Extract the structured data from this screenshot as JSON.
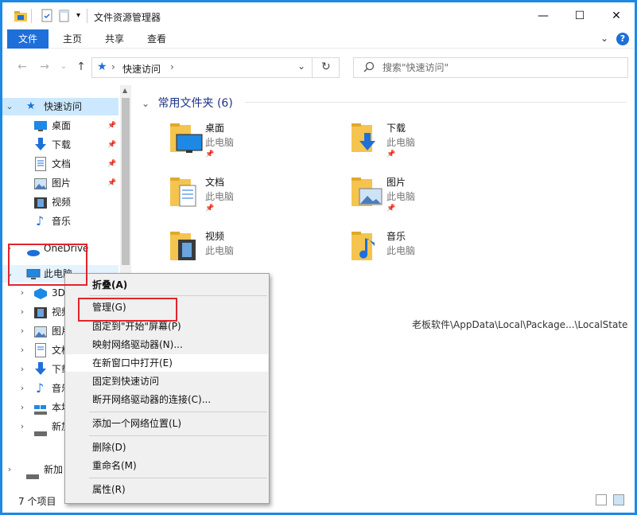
{
  "window": {
    "title": "文件资源管理器",
    "minimize_label": "—",
    "maximize_label": "☐",
    "close_label": "✕"
  },
  "ribbon": {
    "tabs": [
      "文件",
      "主页",
      "共享",
      "查看"
    ],
    "expand_label": "⌄",
    "help_label": "?"
  },
  "address": {
    "path": "快速访问",
    "sep": "›",
    "dropdown": "⌄",
    "refresh": "↻"
  },
  "search": {
    "placeholder": "搜索\"快速访问\""
  },
  "nav": {
    "quick_access": "快速访问",
    "quick_items": [
      "桌面",
      "下载",
      "文档",
      "图片",
      "视频",
      "音乐"
    ],
    "onedrive": "OneDrive",
    "this_pc": "此电脑",
    "pc_items": [
      "3D",
      "视频",
      "图片",
      "文档",
      "下载",
      "音乐",
      "本地",
      "新加"
    ],
    "network": "新加"
  },
  "content": {
    "group_title": "常用文件夹 (6)",
    "folders": [
      {
        "name": "桌面",
        "location": "此电脑"
      },
      {
        "name": "下载",
        "location": "此电脑"
      },
      {
        "name": "文档",
        "location": "此电脑"
      },
      {
        "name": "图片",
        "location": "此电脑"
      },
      {
        "name": "视频",
        "location": "此电脑"
      },
      {
        "name": "音乐",
        "location": "此电脑"
      }
    ],
    "recent_path": "老板软件\\AppData\\Local\\Package...\\LocalState"
  },
  "status": {
    "count": "7 个项目"
  },
  "context_menu": {
    "items": [
      "折叠(A)",
      "管理(G)",
      "固定到\"开始\"屏幕(P)",
      "映射网络驱动器(N)...",
      "在新窗口中打开(E)",
      "固定到快速访问",
      "断开网络驱动器的连接(C)...",
      "添加一个网络位置(L)",
      "删除(D)",
      "重命名(M)",
      "属性(R)"
    ]
  },
  "colors": {
    "accent": "#1e6fd9",
    "highlight_box": "#e3242b",
    "selection": "#cce8ff",
    "folder_yellow": "#f4c44e"
  }
}
